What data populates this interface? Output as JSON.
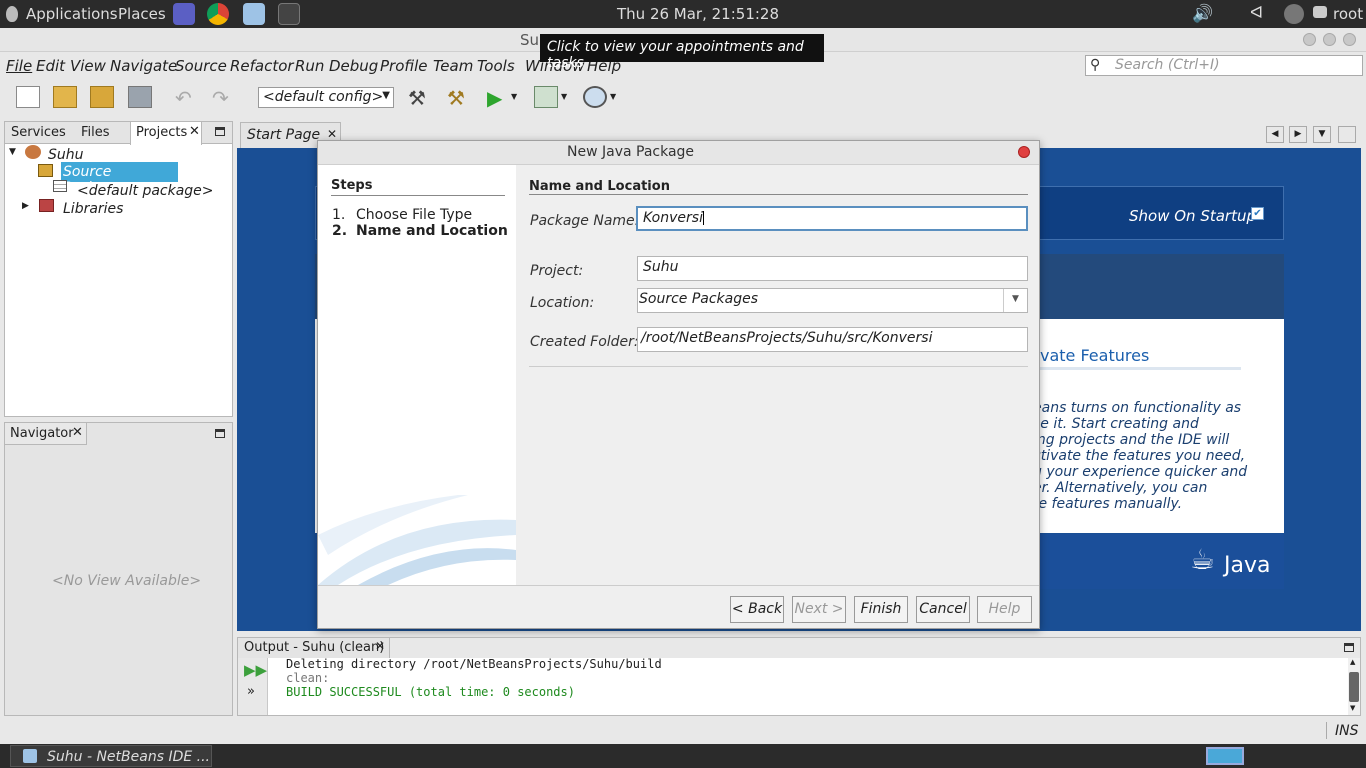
{
  "top_panel": {
    "applications": "Applications",
    "places": "Places",
    "clock": "Thu 26 Mar, 21:51:28",
    "user": "root",
    "tooltip": "Click to view your appointments and tasks"
  },
  "window": {
    "title": "Su"
  },
  "menu": [
    "File",
    "Edit",
    "View",
    "Navigate",
    "Source",
    "Refactor",
    "Run",
    "Debug",
    "Profile",
    "Team",
    "Tools",
    "Window",
    "Help"
  ],
  "search": {
    "placeholder": "Search (Ctrl+I)"
  },
  "toolbar": {
    "config": "<default config>"
  },
  "projects_panel": {
    "tabs": [
      "Services",
      "Files",
      "Projects"
    ],
    "tree": {
      "project": "Suhu",
      "source_packages": "Source Packages",
      "default_package": "<default package>",
      "libraries": "Libraries"
    }
  },
  "navigator": {
    "title": "Navigator",
    "empty": "<No View Available>"
  },
  "editor": {
    "tab": "Start Page",
    "show_on_startup": "Show On Startup",
    "features_heading": "vate Features",
    "features_text": [
      "eans turns on functionality as",
      "se it. Start creating and",
      "ing projects and the IDE will",
      "ctivate the features you need,",
      "g your experience quicker and",
      "er. Alternatively, you can",
      "te features manually."
    ],
    "java_logo": "Java"
  },
  "dialog": {
    "title": "New Java Package",
    "steps_heading": "Steps",
    "steps": [
      {
        "num": "1.",
        "label": "Choose File Type"
      },
      {
        "num": "2.",
        "label": "Name and Location"
      }
    ],
    "section_heading": "Name and Location",
    "package_name_label": "Package Name:",
    "package_name_value": "Konversi",
    "project_label": "Project:",
    "project_value": "Suhu",
    "location_label": "Location:",
    "location_value": "Source Packages",
    "created_folder_label": "Created Folder:",
    "created_folder_value": "/root/NetBeansProjects/Suhu/src/Konversi",
    "buttons": {
      "back": "< Back",
      "next": "Next >",
      "finish": "Finish",
      "cancel": "Cancel",
      "help": "Help"
    }
  },
  "output": {
    "title": "Output - Suhu (clean)",
    "lines": [
      "Deleting directory /root/NetBeansProjects/Suhu/build",
      "clean:",
      "BUILD SUCCESSFUL (total time: 0 seconds)"
    ],
    "success_color": "#1e8a1e"
  },
  "status": {
    "mode": "INS"
  },
  "taskbar": {
    "item": "Suhu - NetBeans IDE ..."
  }
}
